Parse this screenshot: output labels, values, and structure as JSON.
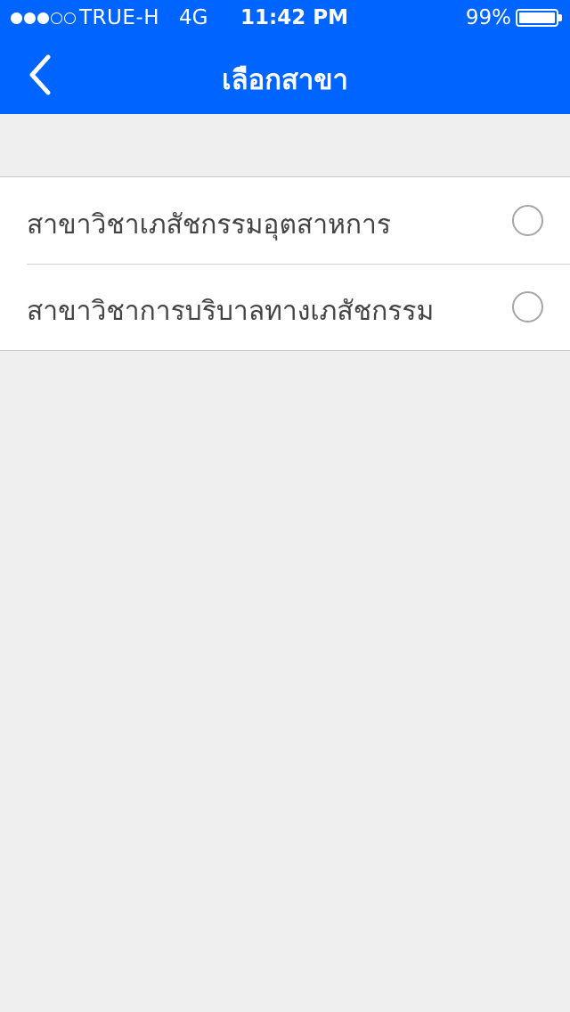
{
  "status_bar": {
    "carrier": "TRUE-H",
    "network": "4G",
    "time": "11:42 PM",
    "battery_percent": "99%",
    "signal_bars_filled": 3,
    "signal_bars_total": 5,
    "battery_level": 0.99
  },
  "nav": {
    "back_icon": "chevron-left-icon",
    "title": "เลือกสาขา"
  },
  "branches": {
    "items": [
      {
        "label": "สาขาวิชาเภสัชกรรมอุตสาหการ",
        "selected": false
      },
      {
        "label": "สาขาวิชาการบริบาลทางเภสัชกรรม",
        "selected": false
      }
    ]
  },
  "colors": {
    "header_bg": "#0064ff",
    "page_bg": "#efefef",
    "radio_border": "#a5a5a5",
    "text": "#444444"
  }
}
